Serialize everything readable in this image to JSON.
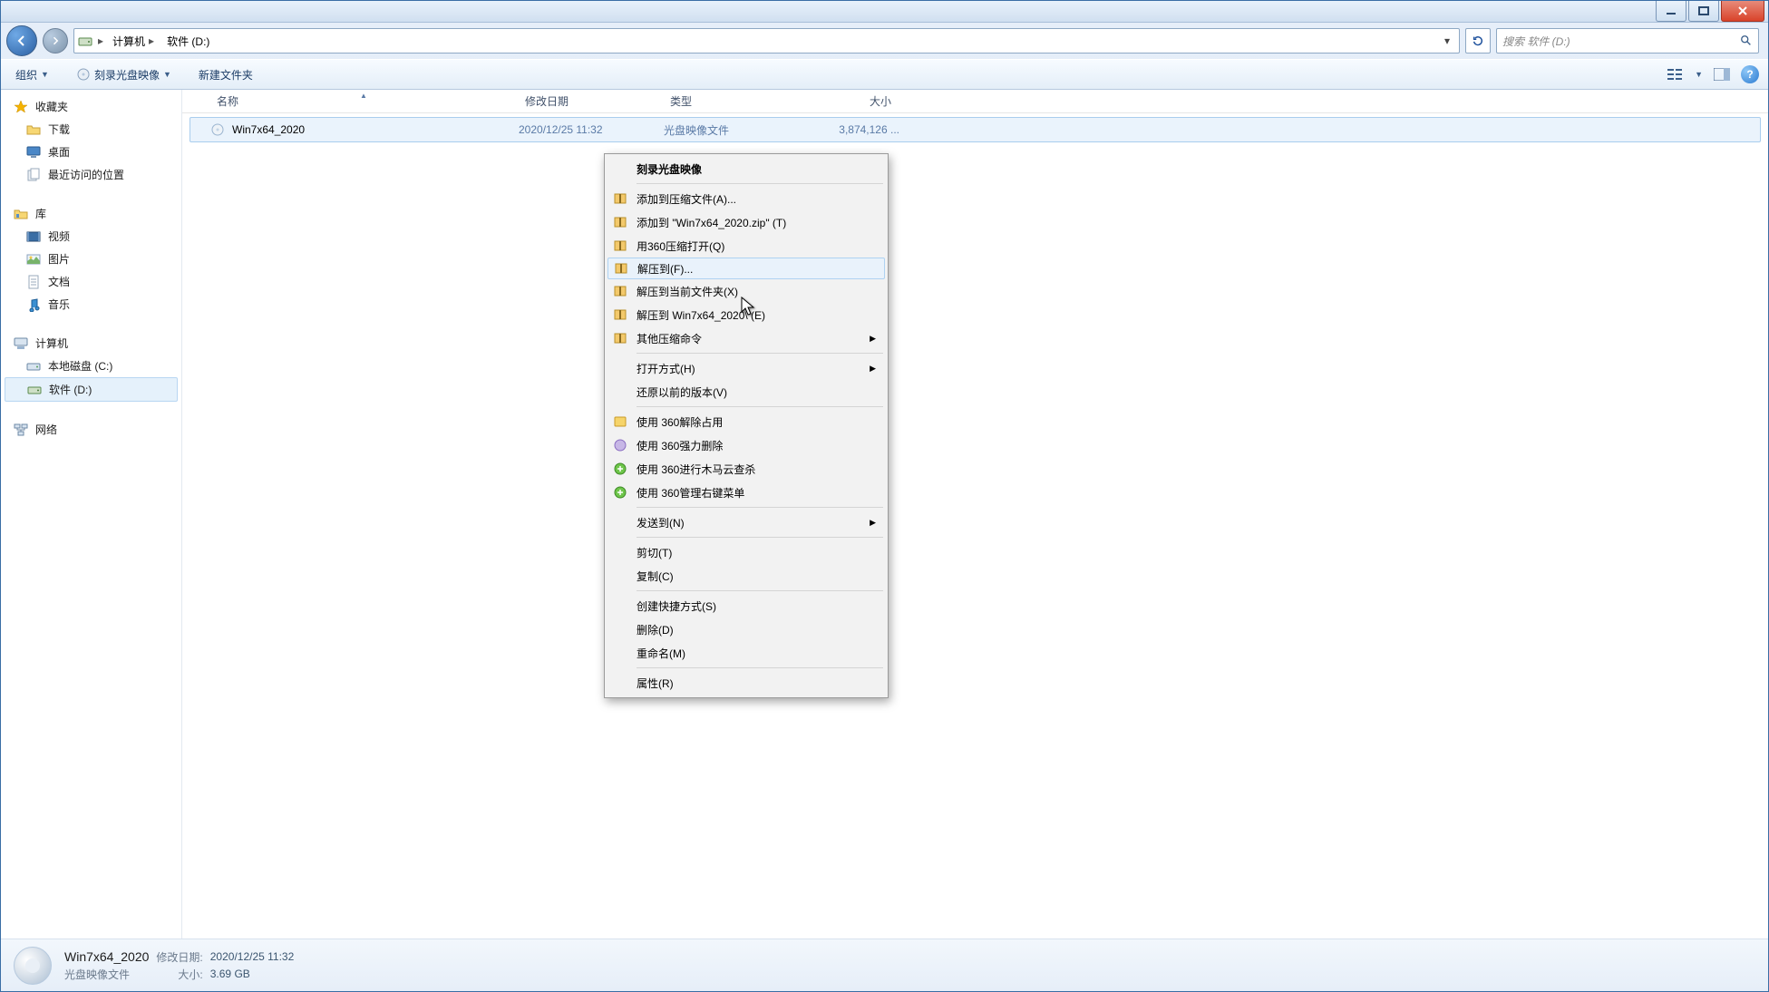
{
  "breadcrumb": {
    "root_icon": "computer-icon",
    "seg1": "计算机",
    "seg2": "软件 (D:)"
  },
  "search": {
    "placeholder": "搜索 软件 (D:)"
  },
  "toolbar": {
    "organize": "组织",
    "burn": "刻录光盘映像",
    "newfolder": "新建文件夹"
  },
  "columns": {
    "name": "名称",
    "date": "修改日期",
    "type": "类型",
    "size": "大小"
  },
  "file": {
    "name": "Win7x64_2020",
    "date": "2020/12/25 11:32",
    "type": "光盘映像文件",
    "size": "3,874,126 ..."
  },
  "sidebar": {
    "favorites": "收藏夹",
    "downloads": "下载",
    "desktop": "桌面",
    "recent": "最近访问的位置",
    "libraries": "库",
    "videos": "视频",
    "pictures": "图片",
    "documents": "文档",
    "music": "音乐",
    "computer": "计算机",
    "drive_c": "本地磁盘 (C:)",
    "drive_d": "软件 (D:)",
    "network": "网络"
  },
  "ctx": {
    "burn": "刻录光盘映像",
    "add_archive": "添加到压缩文件(A)...",
    "add_zip": "添加到 \"Win7x64_2020.zip\" (T)",
    "open_360zip": "用360压缩打开(Q)",
    "extract_to": "解压到(F)...",
    "extract_here": "解压到当前文件夹(X)",
    "extract_folder": "解压到 Win7x64_2020\\ (E)",
    "other_zip": "其他压缩命令",
    "open_with": "打开方式(H)",
    "restore_prev": "还原以前的版本(V)",
    "unlock_360": "使用 360解除占用",
    "force_del_360": "使用 360强力删除",
    "scan_360": "使用 360进行木马云查杀",
    "manage_menu_360": "使用 360管理右键菜单",
    "send_to": "发送到(N)",
    "cut": "剪切(T)",
    "copy": "复制(C)",
    "shortcut": "创建快捷方式(S)",
    "delete": "删除(D)",
    "rename": "重命名(M)",
    "properties": "属性(R)"
  },
  "details": {
    "name": "Win7x64_2020",
    "type": "光盘映像文件",
    "date_k": "修改日期:",
    "date_v": "2020/12/25 11:32",
    "size_k": "大小:",
    "size_v": "3.69 GB"
  }
}
